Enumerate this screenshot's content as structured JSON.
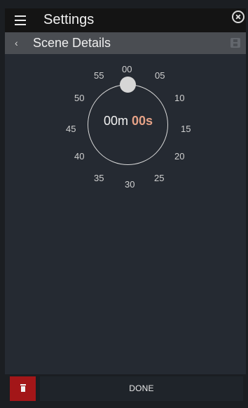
{
  "header": {
    "title": "Settings"
  },
  "subheader": {
    "title": "Scene Details"
  },
  "dial": {
    "labels": [
      "00",
      "05",
      "10",
      "15",
      "20",
      "25",
      "30",
      "35",
      "40",
      "45",
      "50",
      "55"
    ],
    "minutes": "00m",
    "seconds": "00s"
  },
  "footer": {
    "done_label": "DONE"
  },
  "icons": {
    "menu": "menu-icon",
    "close": "close-circle-icon",
    "back": "chevron-left-icon",
    "save": "save-icon",
    "delete": "trash-icon"
  },
  "colors": {
    "accent": "#e6a287",
    "danger": "#a31618",
    "header": "#141414",
    "subheader": "#4a4d52",
    "content": "#252a32"
  }
}
